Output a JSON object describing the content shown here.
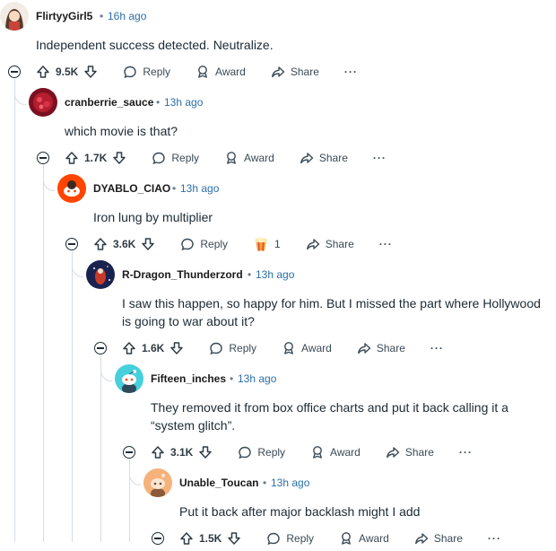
{
  "comments": [
    {
      "username": "FlirtyyGirl5",
      "time": "16h ago",
      "text": "Independent success detected. Neutralize.",
      "votes": "9.5K",
      "reply": "Reply",
      "award": "Award",
      "share": "Share",
      "more": "···"
    },
    {
      "username": "cranberrie_sauce",
      "time": "13h ago",
      "text": "which movie is that?",
      "votes": "1.7K",
      "reply": "Reply",
      "award": "Award",
      "share": "Share",
      "more": "···"
    },
    {
      "username": "DYABLO_CIAO",
      "time": "13h ago",
      "text": "Iron lung by multiplier",
      "votes": "3.6K",
      "reply": "Reply",
      "award_count": "1",
      "share": "Share",
      "more": "···"
    },
    {
      "username": "R-Dragon_Thunderzord",
      "time": "13h ago",
      "text": "I saw this happen, so happy for him. But I missed the part where Hollywood is going to war about it?",
      "votes": "1.6K",
      "reply": "Reply",
      "award": "Award",
      "share": "Share",
      "more": "···"
    },
    {
      "username": "Fifteen_inches",
      "time": "13h ago",
      "text": "They removed it from box office charts and put it back calling it a “system glitch”.",
      "votes": "3.1K",
      "reply": "Reply",
      "award": "Award",
      "share": "Share",
      "more": "···"
    },
    {
      "username": "Unable_Toucan",
      "time": "13h ago",
      "text": "Put it back after major backlash might I add",
      "votes": "1.5K",
      "reply": "Reply",
      "award": "Award",
      "share": "Share",
      "more": "···"
    }
  ],
  "separator": "•",
  "colors": {
    "thread_line": "#d6dde2",
    "timestamp": "#2b6fa8",
    "text": "#1c2a33"
  }
}
